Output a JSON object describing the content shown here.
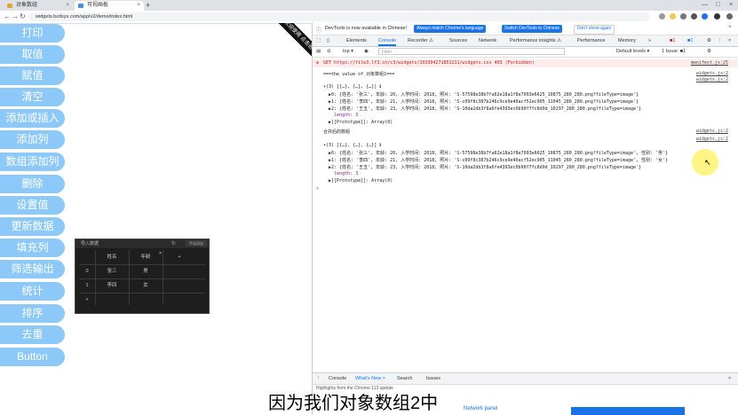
{
  "browser": {
    "tabs": [
      {
        "title": "对象数组"
      },
      {
        "title": "可视画板"
      }
    ],
    "url": "widgets.bzdsys.com/app/v2/demo/index.html"
  },
  "left_buttons": [
    "打印",
    "取值",
    "赋值",
    "清空",
    "添加或插入",
    "添加列",
    "数组添加列",
    "删除",
    "设置值",
    "更新数据",
    "填充列",
    "筛选输出",
    "统计",
    "排序",
    "去重",
    "Button"
  ],
  "sheet": {
    "title": "导入数据",
    "button": "手动添加",
    "headers": [
      "姓名",
      "年龄",
      "+"
    ],
    "rows": [
      {
        "index": "0",
        "name": "张三",
        "age": "男"
      },
      {
        "index": "1",
        "name": "李四",
        "age": "女"
      }
    ],
    "add": "+"
  },
  "ribbon": "欢迎使用 点击进入",
  "devtools": {
    "info_msg": "DevTools is now available in Chinese!",
    "info_btn1": "Always match Chrome's language",
    "info_btn2": "Switch DevTools to Chinese",
    "info_btn3": "Don't show again",
    "tabs": [
      "Elements",
      "Console",
      "Recorder ⚠",
      "Sources",
      "Network",
      "Performance insights ⚠",
      "Performance",
      "Memory",
      "»"
    ],
    "toolbar": {
      "context": "top ▾",
      "filter": "Filter",
      "levels": "Default levels ▾",
      "issues": "1 Issue: ■1"
    },
    "error": "GET https://file3.lf3.cn/c3/widgets/103304271851211/widgets.css 403 (Forbidden)",
    "error_src": "manifest.js:25",
    "lines": [
      "===the value of 对象数组1===",
      "▾(3) [{…}, {…}, {…}] ℹ",
      "  ▶0: {姓名: '张三', 年龄: 20, 入学时间: 2018, 照片: 'S-57598e38b7fa62e18a1f8e7093e6625_10875_280_280.png?fileType=image'}",
      "  ▶1: {姓名: '李四', 年龄: 21, 入学时间: 2018, 照片: 'S-c09f8c387b246c9ce9e40acf52ec905_11045_280_280.png?fileType=image'}",
      "  ▶2: {姓名: '王五', 年龄: 23, 入学时间: 2018, 照片: 'S-10da2db3f8a6fe4393ec0b90f7fc8d9d_10297_280_280.png?fileType=image'}",
      "    length: 3",
      "  ▶[[Prototype]]: Array(0)",
      "合并后的数组",
      "▾(3) [{…}, {…}, {…}] ℹ",
      "  ▶0: {姓名: '张三', 年龄: 20, 入学时间: 2018, 照片: 'S-57598e38b7fa62e18a1f8e7093e6625_10875_280_280.png?fileType=image', 性别: '男'}",
      "  ▶1: {姓名: '李四', 年龄: 21, 入学时间: 2018, 照片: 'S-c09f8c387b246c9ce9e40acf52ec905_11045_280_280.png?fileType=image', 性别: '女'}",
      "  ▶2: {姓名: '王五', 年龄: 23, 入学时间: 2018, 照片: 'S-10da2db3f8a6fe4393ec0b90f7fc8d9d_10297_280_280.png?fileType=image'}",
      "    length: 3",
      "  ▶[[Prototype]]: Array(0)",
      ">"
    ],
    "sources": [
      "widgets.js:2",
      "widgets.js:2",
      "widgets.js:2",
      "widgets.js:2"
    ],
    "drawer_tabs": [
      "Console",
      "What's New ×",
      "Search",
      "Issues"
    ],
    "drawer_text": "Highlights from the Chrome 113 update",
    "drawer_more": "Network panel"
  },
  "subtitle": "因为我们对象数组2中"
}
